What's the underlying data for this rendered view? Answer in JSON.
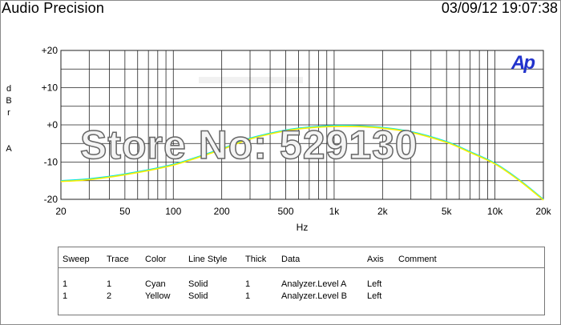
{
  "header": {
    "title": "Audio Precision",
    "timestamp": "03/09/12 19:07:38"
  },
  "watermark": "Store No: 529130",
  "logo": "Ap",
  "chart_data": {
    "type": "line",
    "xscale": "log",
    "xlim": [
      20,
      20000
    ],
    "ylim": [
      -20,
      20
    ],
    "xlabel": "Hz",
    "ylabel": [
      "d",
      "B",
      "r",
      "",
      "A"
    ],
    "grid": true,
    "x_ticks": [
      {
        "v": 20,
        "label": "20"
      },
      {
        "v": 50,
        "label": "50"
      },
      {
        "v": 100,
        "label": "100"
      },
      {
        "v": 200,
        "label": "200"
      },
      {
        "v": 500,
        "label": "500"
      },
      {
        "v": 1000,
        "label": "1k"
      },
      {
        "v": 2000,
        "label": "2k"
      },
      {
        "v": 5000,
        "label": "5k"
      },
      {
        "v": 10000,
        "label": "10k"
      },
      {
        "v": 20000,
        "label": "20k"
      }
    ],
    "y_ticks": [
      {
        "v": 20,
        "label": "+20"
      },
      {
        "v": 10,
        "label": "+10"
      },
      {
        "v": 0,
        "label": "+0"
      },
      {
        "v": -10,
        "label": "-10"
      },
      {
        "v": -20,
        "label": "-20"
      }
    ],
    "series": [
      {
        "name": "Analyzer.Level A",
        "color": "#00e5e5",
        "x": [
          20,
          30,
          50,
          100,
          200,
          300,
          500,
          700,
          1000,
          1500,
          2000,
          3000,
          5000,
          7000,
          10000,
          14000,
          20000
        ],
        "y": [
          -15,
          -14.5,
          -13.2,
          -10.6,
          -6.4,
          -3.6,
          -1.4,
          -0.6,
          -0.2,
          -0.3,
          -0.7,
          -1.8,
          -4.5,
          -7.2,
          -10.3,
          -14.6,
          -20
        ]
      },
      {
        "name": "Analyzer.Level B",
        "color": "#ffee00",
        "x": [
          20,
          30,
          50,
          100,
          200,
          300,
          500,
          700,
          1000,
          1500,
          2000,
          3000,
          5000,
          7000,
          10000,
          14000,
          20000
        ],
        "y": [
          -15.2,
          -14.7,
          -13.4,
          -10.8,
          -6.6,
          -3.8,
          -1.6,
          -0.8,
          -0.4,
          -0.5,
          -0.9,
          -2.0,
          -4.7,
          -7.4,
          -10.5,
          -14.8,
          -20.2
        ]
      }
    ]
  },
  "legend": {
    "headers": [
      "Sweep",
      "Trace",
      "Color",
      "Line Style",
      "Thick",
      "Data",
      "Axis",
      "Comment"
    ],
    "rows": [
      [
        "1",
        "1",
        "Cyan",
        "Solid",
        "1",
        "Analyzer.Level A",
        "Left",
        ""
      ],
      [
        "1",
        "2",
        "Yellow",
        "Solid",
        "1",
        "Analyzer.Level B",
        "Left",
        ""
      ]
    ]
  }
}
